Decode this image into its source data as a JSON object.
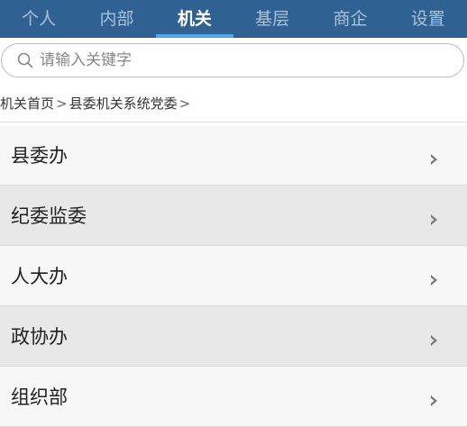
{
  "tabs": [
    {
      "label": "个人",
      "active": false
    },
    {
      "label": "内部",
      "active": false
    },
    {
      "label": "机关",
      "active": true
    },
    {
      "label": "基层",
      "active": false
    },
    {
      "label": "商企",
      "active": false
    },
    {
      "label": "设置",
      "active": false
    }
  ],
  "search": {
    "placeholder": "请输入关键字",
    "value": "",
    "icon": "search-icon"
  },
  "breadcrumb": {
    "items": [
      "机关首页",
      "县委机关系统党委"
    ],
    "separator": ">"
  },
  "list": {
    "items": [
      {
        "label": "县委办",
        "icon": "chevron-right-icon"
      },
      {
        "label": "纪委监委",
        "icon": "chevron-right-icon"
      },
      {
        "label": "人大办",
        "icon": "chevron-right-icon"
      },
      {
        "label": "政协办",
        "icon": "chevron-right-icon"
      },
      {
        "label": "组织部",
        "icon": "chevron-right-icon"
      }
    ]
  },
  "colors": {
    "tabbar_bg": "#2f6292",
    "active_indicator": "#4fa8e6",
    "tab_inactive_text": "#a9c2da",
    "row_light": "#f7f7f7",
    "row_dark": "#e8e8e8"
  }
}
